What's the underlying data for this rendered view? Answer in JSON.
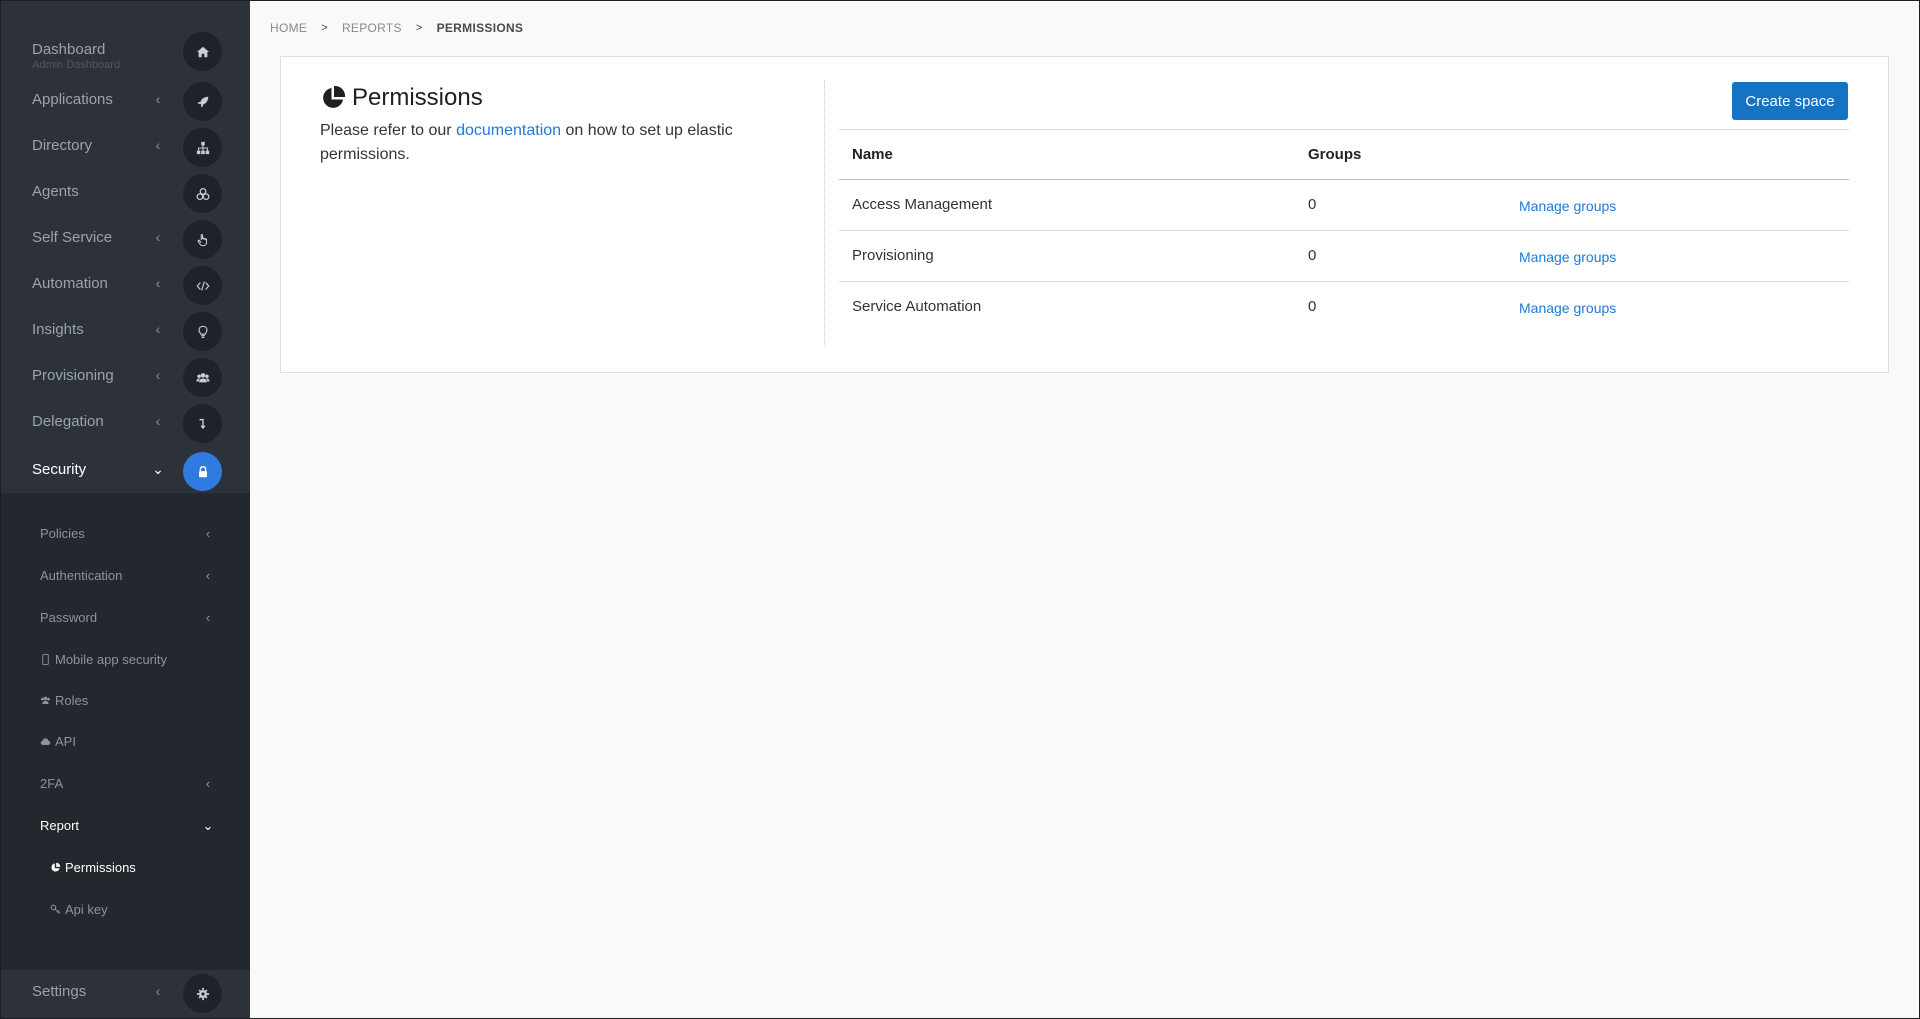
{
  "sidebar": {
    "dashboard": {
      "label": "Dashboard",
      "sub": "Admin Dashboard"
    },
    "menu": [
      {
        "label": "Applications"
      },
      {
        "label": "Directory"
      },
      {
        "label": "Agents"
      },
      {
        "label": "Self Service"
      },
      {
        "label": "Automation"
      },
      {
        "label": "Insights"
      },
      {
        "label": "Provisioning"
      },
      {
        "label": "Delegation"
      },
      {
        "label": "Security"
      }
    ],
    "security_sub": [
      {
        "label": "Policies"
      },
      {
        "label": "Authentication"
      },
      {
        "label": "Password"
      },
      {
        "label": "Mobile app security"
      },
      {
        "label": "Roles"
      },
      {
        "label": "API"
      },
      {
        "label": "2FA"
      },
      {
        "label": "Report"
      }
    ],
    "report_sub": [
      {
        "label": "Permissions"
      },
      {
        "label": "Api key"
      }
    ],
    "settings": {
      "label": "Settings"
    }
  },
  "breadcrumb": {
    "home": "HOME",
    "reports": "REPORTS",
    "current": "PERMISSIONS"
  },
  "page": {
    "title": "Permissions",
    "desc_before": "Please refer to our ",
    "desc_link": "documentation",
    "desc_after": " on how to set up elastic permissions.",
    "create_button": "Create space"
  },
  "table": {
    "headers": {
      "name": "Name",
      "groups": "Groups"
    },
    "rows": [
      {
        "name": "Access Management",
        "groups": "0",
        "action": "Manage groups"
      },
      {
        "name": "Provisioning",
        "groups": "0",
        "action": "Manage groups"
      },
      {
        "name": "Service Automation",
        "groups": "0",
        "action": "Manage groups"
      }
    ]
  },
  "colors": {
    "accent": "#2f7be0",
    "button": "#1473c2",
    "link": "#1f7ad8",
    "sidebar": "#23272e"
  }
}
